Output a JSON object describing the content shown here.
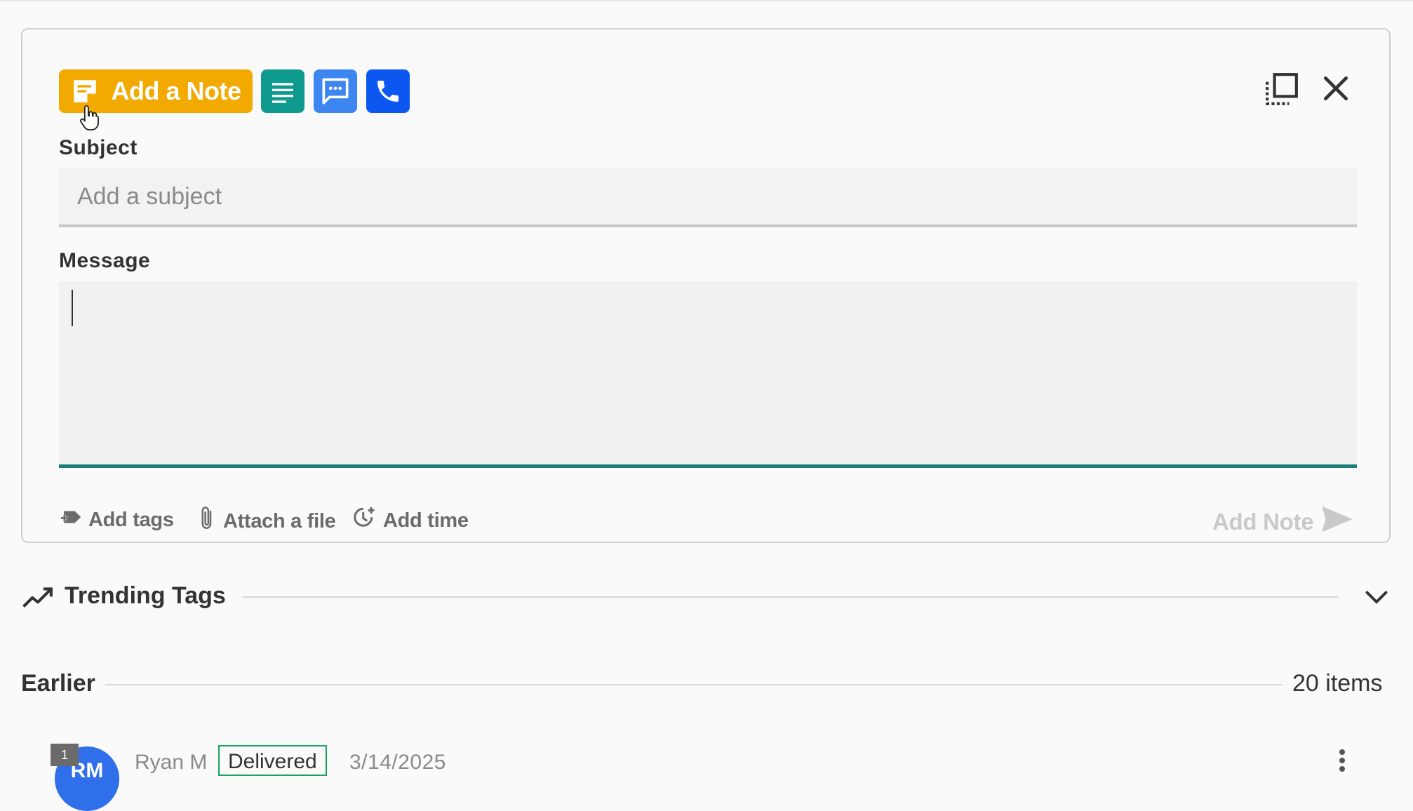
{
  "composer": {
    "note_button_label": "Add a Note",
    "subject_label": "Subject",
    "subject_placeholder": "Add a subject",
    "subject_value": "",
    "message_label": "Message",
    "message_value": "",
    "tools": {
      "add_tags": "Add tags",
      "attach_file": "Attach a file",
      "add_time": "Add time"
    },
    "submit_label": "Add Note",
    "colors": {
      "note": "#f2a900",
      "text": "#0e9a8e",
      "sms": "#3d86f2",
      "call": "#0b57f0",
      "focus_underline": "#1b7f7a"
    },
    "icons": [
      "note-icon",
      "text-lines-icon",
      "chat-icon",
      "phone-icon",
      "expand-icon",
      "close-icon",
      "tag-icon",
      "paperclip-icon",
      "clock-icon",
      "send-icon"
    ]
  },
  "trending": {
    "title": "Trending Tags",
    "icon": "trend-line-icon"
  },
  "earlier": {
    "title": "Earlier",
    "count": "20 items"
  },
  "items": [
    {
      "badge": "1",
      "initials": "RM",
      "author": "Ryan M",
      "status": "Delivered",
      "status_color": "#1aa35c",
      "date": "3/14/2025"
    }
  ]
}
